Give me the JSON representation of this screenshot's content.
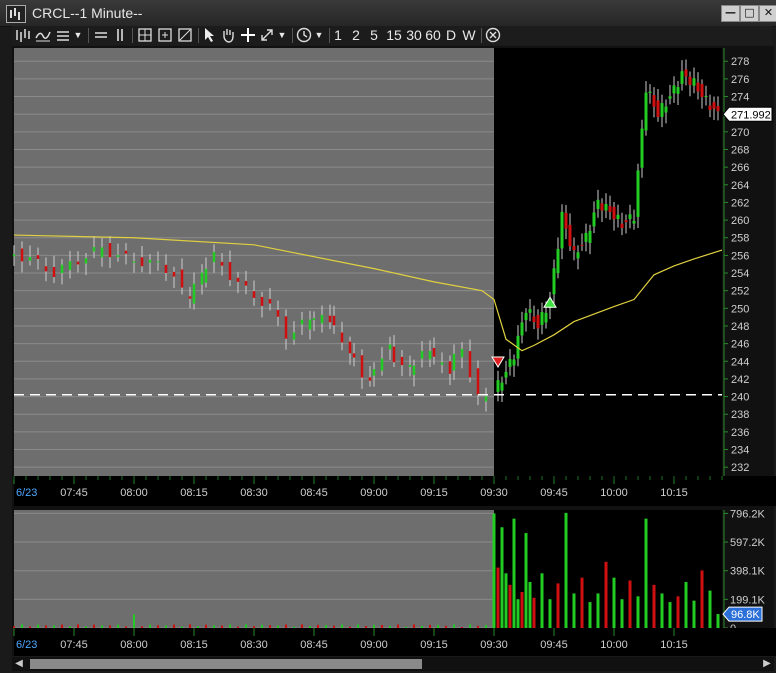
{
  "window": {
    "title": "CRCL--1 Minute--",
    "controls": {
      "minimize": "—",
      "restore": "□",
      "close": "✕"
    }
  },
  "toolbar": {
    "interval_buttons": [
      "1",
      "2",
      "5",
      "15",
      "30",
      "60",
      "D",
      "W"
    ],
    "icons": [
      "draw-bars-icon",
      "indicator-icon",
      "menu-arrow-icon",
      "hline-icon",
      "vline-icon",
      "zoom-icon",
      "fit-icon",
      "scale-icon",
      "cursor-icon",
      "hand-icon",
      "crosshair-icon",
      "resize-icon",
      "dropdown-icon",
      "clock-icon",
      "dropdown-icon",
      "close-circle-icon"
    ]
  },
  "colors": {
    "up": "#22cc22",
    "down": "#d01010",
    "premarket_bg": "#6e6e6e",
    "session_bg": "#000000",
    "vwap": "#e0d040",
    "dashed_level": "#ffffff",
    "axis_text": "#cfcfcf",
    "gridline": "#8a8a8a"
  },
  "chart_data": [
    {
      "type": "candlestick",
      "name": "price",
      "y_ticks": [
        232,
        234,
        236,
        238,
        240,
        242,
        244,
        246,
        248,
        250,
        252,
        254,
        256,
        258,
        260,
        262,
        264,
        266,
        268,
        270,
        272,
        274,
        276,
        278
      ],
      "ylim": [
        231,
        279.5
      ],
      "last_price_label": "271.992",
      "last_price": 271.992,
      "dashed_level": 240.2,
      "x_tick_labels": [
        "6/23",
        "07:45",
        "08:00",
        "08:15",
        "08:30",
        "08:45",
        "09:00",
        "09:15",
        "09:30",
        "09:45",
        "10:00",
        "10:15"
      ],
      "x_tick_times": [
        "07:30",
        "07:45",
        "08:00",
        "08:15",
        "08:30",
        "08:45",
        "09:00",
        "09:15",
        "09:30",
        "09:45",
        "10:00",
        "10:15"
      ],
      "time_range": [
        "07:30",
        "10:27"
      ],
      "session_open": "09:30",
      "premarket_close_series": [
        {
          "t": "07:30",
          "c": 256.5
        },
        {
          "t": "07:36",
          "c": 255.6
        },
        {
          "t": "07:42",
          "c": 254.0
        },
        {
          "t": "07:48",
          "c": 255.5
        },
        {
          "t": "07:54",
          "c": 256.8
        },
        {
          "t": "08:00",
          "c": 255.6
        },
        {
          "t": "08:06",
          "c": 255.2
        },
        {
          "t": "08:12",
          "c": 254.0
        },
        {
          "t": "08:15",
          "c": 250.8
        },
        {
          "t": "08:18",
          "c": 253.5
        },
        {
          "t": "08:22",
          "c": 255.8
        },
        {
          "t": "08:26",
          "c": 253.8
        },
        {
          "t": "08:30",
          "c": 252.0
        },
        {
          "t": "08:36",
          "c": 250.2
        },
        {
          "t": "08:40",
          "c": 247.0
        },
        {
          "t": "08:45",
          "c": 248.5
        },
        {
          "t": "08:50",
          "c": 248.8
        },
        {
          "t": "08:55",
          "c": 245.5
        },
        {
          "t": "09:00",
          "c": 242.0
        },
        {
          "t": "09:05",
          "c": 245.5
        },
        {
          "t": "09:10",
          "c": 243.0
        },
        {
          "t": "09:15",
          "c": 245.0
        },
        {
          "t": "09:20",
          "c": 243.0
        },
        {
          "t": "09:24",
          "c": 245.5
        },
        {
          "t": "09:28",
          "c": 240.0
        },
        {
          "t": "09:30",
          "c": 239.5
        }
      ],
      "session_close_series": [
        {
          "t": "09:31",
          "c": 240.5
        },
        {
          "t": "09:34",
          "c": 242.8
        },
        {
          "t": "09:36",
          "c": 244.8
        },
        {
          "t": "09:39",
          "c": 250.0
        },
        {
          "t": "09:42",
          "c": 248.0
        },
        {
          "t": "09:45",
          "c": 251.0
        },
        {
          "t": "09:48",
          "c": 260.5
        },
        {
          "t": "09:51",
          "c": 256.0
        },
        {
          "t": "09:54",
          "c": 258.0
        },
        {
          "t": "09:57",
          "c": 262.0
        },
        {
          "t": "10:00",
          "c": 261.0
        },
        {
          "t": "10:03",
          "c": 259.5
        },
        {
          "t": "10:06",
          "c": 260.5
        },
        {
          "t": "10:09",
          "c": 275.0
        },
        {
          "t": "10:12",
          "c": 272.0
        },
        {
          "t": "10:15",
          "c": 274.0
        },
        {
          "t": "10:18",
          "c": 276.5
        },
        {
          "t": "10:21",
          "c": 275.5
        },
        {
          "t": "10:24",
          "c": 273.5
        },
        {
          "t": "10:27",
          "c": 271.992
        }
      ],
      "vwap_series": [
        {
          "t": "07:30",
          "v": 258.3
        },
        {
          "t": "08:00",
          "v": 258.0
        },
        {
          "t": "08:30",
          "v": 257.2
        },
        {
          "t": "09:00",
          "v": 254.5
        },
        {
          "t": "09:15",
          "v": 253.0
        },
        {
          "t": "09:27",
          "v": 252.0
        },
        {
          "t": "09:30",
          "v": 251.0
        },
        {
          "t": "09:33",
          "v": 246.5
        },
        {
          "t": "09:37",
          "v": 245.2
        },
        {
          "t": "09:40",
          "v": 245.8
        },
        {
          "t": "09:45",
          "v": 247.0
        },
        {
          "t": "09:50",
          "v": 248.5
        },
        {
          "t": "10:00",
          "v": 250.2
        },
        {
          "t": "10:05",
          "v": 251.0
        },
        {
          "t": "10:10",
          "v": 253.8
        },
        {
          "t": "10:15",
          "v": 254.8
        },
        {
          "t": "10:20",
          "v": 255.6
        },
        {
          "t": "10:27",
          "v": 256.6
        }
      ],
      "markers": [
        {
          "t": "09:31",
          "price": 243.8,
          "type": "sell-arrow",
          "color": "#e02020"
        },
        {
          "t": "09:44",
          "price": 250.8,
          "type": "buy-arrow",
          "color": "#40e040"
        }
      ]
    },
    {
      "type": "bar",
      "name": "volume",
      "y_tick_labels": [
        "796.2K",
        "597.2K",
        "398.1K",
        "199.1K",
        "0"
      ],
      "y_ticks": [
        796200,
        597200,
        398100,
        199100,
        0
      ],
      "ylim": [
        0,
        820000
      ],
      "last_volume_label": "96.8K",
      "last_volume": 96800,
      "premarket_typical_volume": 18000,
      "session_volume": [
        {
          "t": "09:30",
          "v": 796000
        },
        {
          "t": "09:31",
          "v": 420000
        },
        {
          "t": "09:32",
          "v": 700000
        },
        {
          "t": "09:33",
          "v": 380000
        },
        {
          "t": "09:34",
          "v": 300000
        },
        {
          "t": "09:35",
          "v": 760000
        },
        {
          "t": "09:36",
          "v": 200000
        },
        {
          "t": "09:37",
          "v": 250000
        },
        {
          "t": "09:38",
          "v": 660000
        },
        {
          "t": "09:39",
          "v": 320000
        },
        {
          "t": "09:40",
          "v": 210000
        },
        {
          "t": "09:42",
          "v": 380000
        },
        {
          "t": "09:44",
          "v": 200000
        },
        {
          "t": "09:46",
          "v": 310000
        },
        {
          "t": "09:48",
          "v": 800000
        },
        {
          "t": "09:50",
          "v": 240000
        },
        {
          "t": "09:52",
          "v": 350000
        },
        {
          "t": "09:54",
          "v": 180000
        },
        {
          "t": "09:56",
          "v": 240000
        },
        {
          "t": "09:58",
          "v": 460000
        },
        {
          "t": "10:00",
          "v": 350000
        },
        {
          "t": "10:02",
          "v": 200000
        },
        {
          "t": "10:04",
          "v": 330000
        },
        {
          "t": "10:06",
          "v": 220000
        },
        {
          "t": "10:08",
          "v": 760000
        },
        {
          "t": "10:10",
          "v": 300000
        },
        {
          "t": "10:12",
          "v": 240000
        },
        {
          "t": "10:14",
          "v": 180000
        },
        {
          "t": "10:16",
          "v": 220000
        },
        {
          "t": "10:18",
          "v": 320000
        },
        {
          "t": "10:20",
          "v": 190000
        },
        {
          "t": "10:22",
          "v": 400000
        },
        {
          "t": "10:24",
          "v": 260000
        },
        {
          "t": "10:26",
          "v": 96800
        }
      ]
    }
  ]
}
